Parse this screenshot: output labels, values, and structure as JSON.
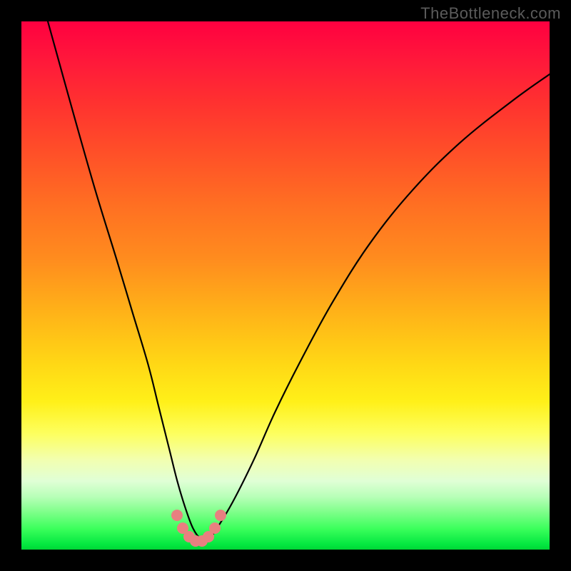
{
  "attribution": "TheBottleneck.com",
  "chart_data": {
    "type": "line",
    "title": "",
    "xlabel": "",
    "ylabel": "",
    "xlim": [
      0,
      100
    ],
    "ylim": [
      0,
      100
    ],
    "series": [
      {
        "name": "bottleneck-curve",
        "x": [
          5,
          10,
          14,
          18,
          21,
          24,
          26,
          28,
          29.5,
          31,
          32.5,
          34,
          35.5,
          37,
          40,
          44,
          48,
          53,
          59,
          66,
          74,
          83,
          93,
          100
        ],
        "y": [
          100,
          82,
          68,
          55,
          45,
          35,
          27,
          19,
          13,
          8,
          4,
          2,
          2,
          4,
          9,
          17,
          26,
          36,
          47,
          58,
          68,
          77,
          85,
          90
        ]
      }
    ],
    "markers": {
      "name": "optimum-region",
      "points": [
        {
          "x": 29.5,
          "y": 6.5
        },
        {
          "x": 30.6,
          "y": 4.0
        },
        {
          "x": 31.8,
          "y": 2.4
        },
        {
          "x": 33.0,
          "y": 1.6
        },
        {
          "x": 34.2,
          "y": 1.6
        },
        {
          "x": 35.4,
          "y": 2.4
        },
        {
          "x": 36.6,
          "y": 4.0
        },
        {
          "x": 37.7,
          "y": 6.5
        }
      ]
    },
    "background_gradient": {
      "top": "#ff0040",
      "bottom": "#00d636",
      "meaning": "red=high bottleneck, green=optimal"
    }
  }
}
